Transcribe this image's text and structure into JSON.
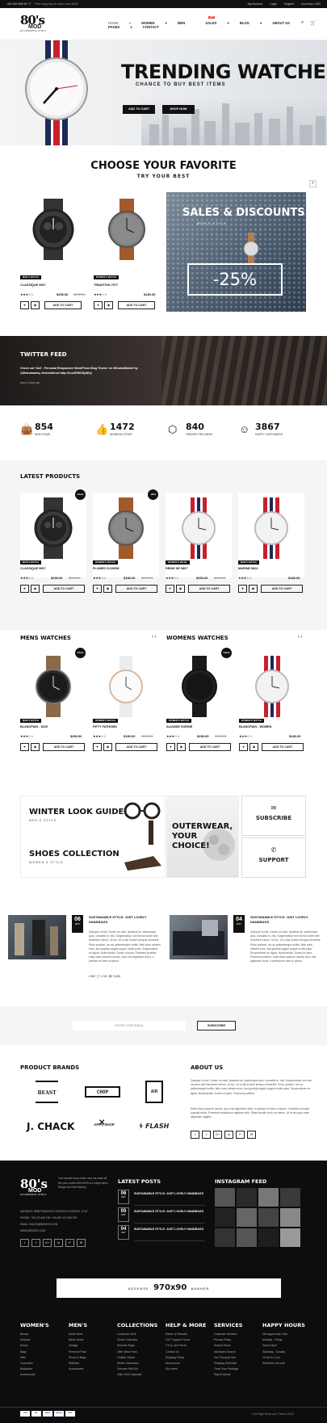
{
  "topbar": {
    "phone": "+84 908 908 08 77",
    "promo": "Free shipping for order over $199",
    "account": "My Account",
    "login": "Login",
    "language": "English",
    "currency": "Currency: USD"
  },
  "nav": {
    "logo_main": "80's",
    "logo_mod": "MOD",
    "logo_sub": "ECOMMERCE HTML5",
    "items": [
      "HOME",
      "WOMEN",
      "MEN",
      "SALES",
      "BLOG",
      "ABOUT US",
      "PAGES",
      "CONTACT"
    ],
    "hot_label": "HOT",
    "chevron_icon": "chevron-down-icon",
    "search_icon": "search-icon",
    "cart_icon": "cart-icon",
    "cart_count": "0"
  },
  "hero": {
    "title": "TRENDING WATCHES",
    "subtitle": "CHANCE TO BUY BEST ITEMS",
    "btn_cart": "ADD TO CART",
    "btn_shop": "SHOP NOW",
    "strap_colors": [
      "#1c2a55",
      "#ffffff",
      "#c8202c"
    ]
  },
  "choose": {
    "title": "CHOOSE YOUR FAVORITE",
    "subtitle": "TRY YOUR BEST",
    "products": [
      {
        "tag": "MEN'S WATCH",
        "name": "CLASSIQUE 9067",
        "stars": "★★★☆☆",
        "price": "$250.00",
        "old": "$260.00"
      },
      {
        "tag": "WOMEN'S WATCH",
        "name": "TRADITION 7077",
        "stars": "★★★☆☆",
        "price": "$180.00",
        "old": ""
      }
    ],
    "add_to_cart": "ADD TO CART",
    "promo_title": "SALES & DISCOUNTS",
    "promo_sub": "MEN'S STYLE",
    "promo_pct": "-25%"
  },
  "twitter": {
    "title": "TWITTER FEED",
    "text": "Check out 'Owl' - Personal Responsive WordPress Blog Theme' on #EnvatoMarket by @8theshadeky #themeforest http://t.co/IERiKDpNGy",
    "time": "about 4 days ago"
  },
  "stats": [
    {
      "num": "854",
      "label": "NEW ITEMS",
      "icon": "bag-icon"
    },
    {
      "num": "1472",
      "label": "WORKING STAFF",
      "icon": "thumbs-up-icon"
    },
    {
      "num": "840",
      "label": "ORDERS PER WEEK",
      "icon": "cube-icon"
    },
    {
      "num": "3867",
      "label": "HAPPY CUSTOMERS",
      "icon": "smile-icon"
    }
  ],
  "latest": {
    "title": "LATEST PRODUCTS",
    "products": [
      {
        "tag": "MEN'S WATCH",
        "name": "CLASSIQUE 9067",
        "stars": "★★★☆☆",
        "price": "$250.00",
        "old": "$260.00",
        "badge": "SALE"
      },
      {
        "tag": "WOMEN'S WATCH",
        "name": "PLUMES GJ10098",
        "stars": "★★★☆☆",
        "price": "$180.00",
        "old": "$200.00",
        "badge": "-20%"
      },
      {
        "tag": "WOMEN'S WEAR",
        "name": "REINE DE 9807",
        "stars": "★★★☆☆",
        "price": "$250.00",
        "old": "$280.00",
        "badge": ""
      },
      {
        "tag": "MEN'S WATCH",
        "name": "MARINE 5823",
        "stars": "★★★☆☆",
        "price": "$180.00",
        "old": "",
        "badge": ""
      }
    ]
  },
  "mens": {
    "title": "MENS WATCHES",
    "products": [
      {
        "tag": "MEN'S WATCH",
        "name": "BLANCPAIN - 3025",
        "stars": "★★★☆☆",
        "price": "$250.00",
        "old": "",
        "badge": "SALE"
      },
      {
        "tag": "WOMEN'S WATCH",
        "name": "FIFTY FATHOMS",
        "stars": "★★★☆☆",
        "price": "$180.00",
        "old": "$200.00",
        "badge": ""
      }
    ]
  },
  "womens": {
    "title": "WOMENS WATCHES",
    "products": [
      {
        "tag": "WOMEN'S WATCH",
        "name": "ALIANDE SOEINE",
        "stars": "★★★☆☆",
        "price": "$250.00",
        "old": "$280.00",
        "badge": "SALE"
      },
      {
        "tag": "WOMEN'S WATCH",
        "name": "BLANCPAIN - WOMEN",
        "stars": "★★★☆☆",
        "price": "$180.00",
        "old": "",
        "badge": ""
      }
    ]
  },
  "banners": {
    "winter": "WINTER LOOK GUIDE",
    "winter_sub": "MEN'S STYLE",
    "shoes": "SHOES COLLECTION",
    "shoes_sub": "WOMEN'S STYLE",
    "outer1": "OUTERWEAR,",
    "outer2": "YOUR",
    "outer3": "CHOICE!",
    "subscribe": "SUBSCRIBE",
    "support": "SUPPORT"
  },
  "blog": [
    {
      "day": "06",
      "month": "MAY",
      "title": "SUSTAINABLE STYLE: JUST LOVELY HANDBAGS",
      "text": "Quisque ut nisi. Donec mi odio, faucibus at, scelerisque quis, convallis in, nisi. Suspendisse non nisl sit amet velit hendrerit rutrum. Ut leo. Ut a nisl id ante tempus hendrerit. Proin pretium, leo ac pellentesque mollis, felis nunc ultrices eros, sed gravida augue augue mollis justo. Suspendisse eu ligula. Nulla facilisi. Donec id justo. Praesent porttitor, nulla vitae posuere iaculis, arcu nisl dignissim dolor, a pretium mi sem ut ipsum.",
      "likes": "582",
      "comments": "4,760",
      "views": "74,834"
    },
    {
      "day": "04",
      "month": "MAY",
      "title": "SUSTAINABLE STYLE: JUST LOVELY HANDBAGS",
      "text": "Quisque ut nisi. Donec mi odio, faucibus at, scelerisque quis, convallis in, nisi. Suspendisse non nisl sit amet velit hendrerit rutrum. Ut leo. Ut a nisl id ante tempus hendrerit. Proin pretium, leo ac pellentesque mollis, felis nunc ultrices eros, sed gravida augue augue mollis justo. Suspendisse eu ligula. Nulla facilisi. Donec id justo. Praesent porttitor, nulla vitae posuere iaculis, arcu nisl dignissim dolor, a pretium mi sem ut ipsum.",
      "likes": "",
      "comments": "",
      "views": ""
    }
  ],
  "newsletter": {
    "placeholder": "ENTER YOUR EMAIL",
    "button": "SUBSCRIBE"
  },
  "brands": {
    "title": "PRODUCT BRANDS",
    "list": [
      "BEAST",
      "CHOP",
      "AIR",
      "J. CHACK",
      "APPS SHOP",
      "FLASH"
    ]
  },
  "about": {
    "title": "ABOUT US",
    "text1": "Quisque ut nisi. Donec mi odio, faucibus at, scelerisque quis, convallis in, nisi. Suspendisse non nisl sit amet velit hendrerit rutrum. Ut leo. Ut a nisl id ante tempus hendrerit. Proin pretium, leo ac pellentesque mollis, felis nunc ultrices eros, sed gravida augue augue mollis justo. Suspendisse eu ligula. Nulla facilisi. Donec id justo. Praesent porttitor.",
    "text2": "Nulla vitae posuere iaculis, arcu nisl dignissim dolor, a pretium mi sem ut ipsum. Curabitur suscipit suscipit tellus. Praesent vestibulum dapibus nibh. Etiam iaculis nunc ac metus. Ut id nisl quis enim dignissim sagittis."
  },
  "footer": {
    "desc": "Your favorite shop online now, we make all the your comfort 80's MOD is a Large Items Range and Fast Delivery",
    "address": "ADDRESS: 5896 FRANCISCO BOSSUTH AVENUE, T5 AT",
    "phone": "PHONE: +84 123 456 789 / +84 800 123 456 789",
    "email": "EMAIL: SALES@80SMOD.COM",
    "web": "WWW.80SMOD.COM",
    "social": [
      "t",
      "f",
      "G+",
      "in",
      "P",
      "✉"
    ],
    "posts_title": "LATEST POSTS",
    "posts": [
      {
        "day": "06",
        "month": "MAY",
        "title": "SUSTAINABLE STYLE: JUST LOVELY HANDBAGS"
      },
      {
        "day": "05",
        "month": "MAY",
        "title": "SUSTAINABLE STYLE: JUST LOVELY HANDBAGS"
      },
      {
        "day": "04",
        "month": "MAY",
        "title": "SUSTAINABLE STYLE: JUST LOVELY HANDBAGS"
      }
    ],
    "insta_title": "INSTAGRAM FEED",
    "ad": "ADSENSE",
    "ad_size": "970x90",
    "ad_label": "BANNER",
    "cols": [
      {
        "title": "WOMEN'S",
        "items": [
          "Blouse",
          "Dresses",
          "Shoes",
          "Bags",
          "Hats",
          "Cosmetics",
          "Bodyforce",
          "Accessories"
        ]
      },
      {
        "title": "MEN'S",
        "items": [
          "Mode Wear",
          "Mens Jeans",
          "Vintage",
          "Premium Pack",
          "Shoes & Bags",
          "Watches",
          "Accessories"
        ]
      },
      {
        "title": "COLLECTIONS",
        "items": [
          "LookBook 2016",
          "Shoes Collection",
          "Summer Bags",
          "Offer Wear Pack",
          "Leather Shoes",
          "Winter Outerwear",
          "Summer Self Girl",
          "Little 2016 Classical"
        ]
      },
      {
        "title": "HELP & MORE",
        "items": [
          "Return & Refunds",
          "24/7 Support Forum",
          "F.A.Q. and Terms",
          "Contact Us",
          "Shipping Policy",
          "My Account",
          "My orders"
        ]
      },
      {
        "title": "SERVICES",
        "items": [
          "Customer Services",
          "Privacy Policy",
          "Search Terms",
          "Advanced Search",
          "Our Personal Info",
          "Shipping Schedule",
          "Track Your Package",
          "Report Abuse"
        ]
      },
      {
        "title": "HAPPY HOURS",
        "items": [
          "08 August each Year",
          "Monday - Friday",
          "9am to 6pm",
          "Saturday - Sunday",
          "10 am to 4 pm",
          "Subscribe via mail"
        ]
      }
    ],
    "payments": [
      "VISA",
      "MC",
      "AMEX",
      "PAYPAL",
      "DISC"
    ],
    "copyright": "© All Right Reserved | Themes 2016"
  }
}
